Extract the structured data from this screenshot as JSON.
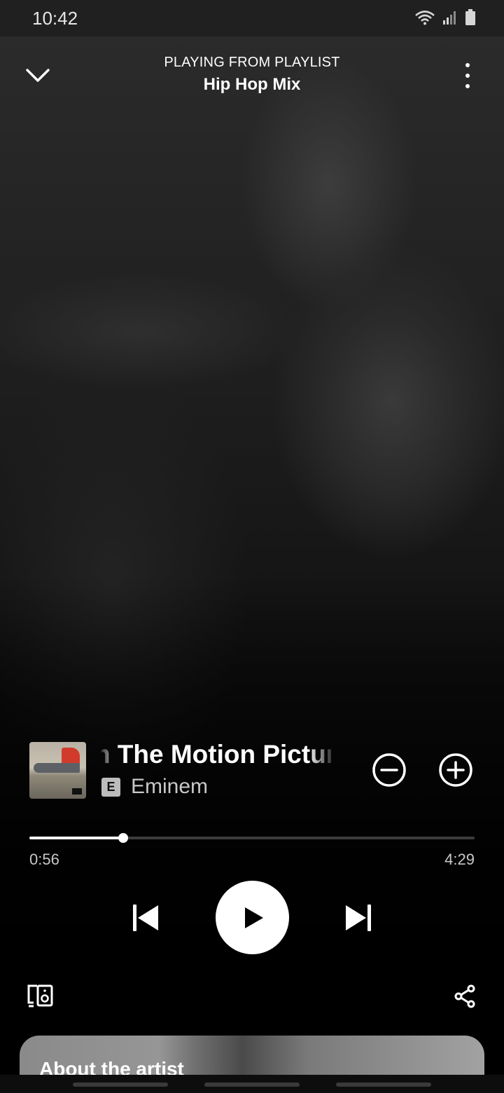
{
  "status_bar": {
    "time": "10:42"
  },
  "header": {
    "context_label": "PLAYING FROM PLAYLIST",
    "playlist_name": "Hip Hop Mix"
  },
  "track": {
    "title": "From The Motion Picture",
    "explicit_badge": "E",
    "artist": "Eminem"
  },
  "playback": {
    "elapsed": "0:56",
    "total": "4:29",
    "progress_fraction": 0.21
  },
  "about": {
    "title": "About the artist"
  },
  "icons": {
    "collapse": "chevron-down-icon",
    "more": "more-vertical-icon",
    "remove": "minus-circle-icon",
    "add": "plus-circle-icon",
    "prev": "skip-previous-icon",
    "play": "play-icon",
    "next": "skip-next-icon",
    "devices": "connect-devices-icon",
    "share": "share-icon"
  },
  "colors": {
    "accent": "#ffffff",
    "background": "#000000"
  }
}
